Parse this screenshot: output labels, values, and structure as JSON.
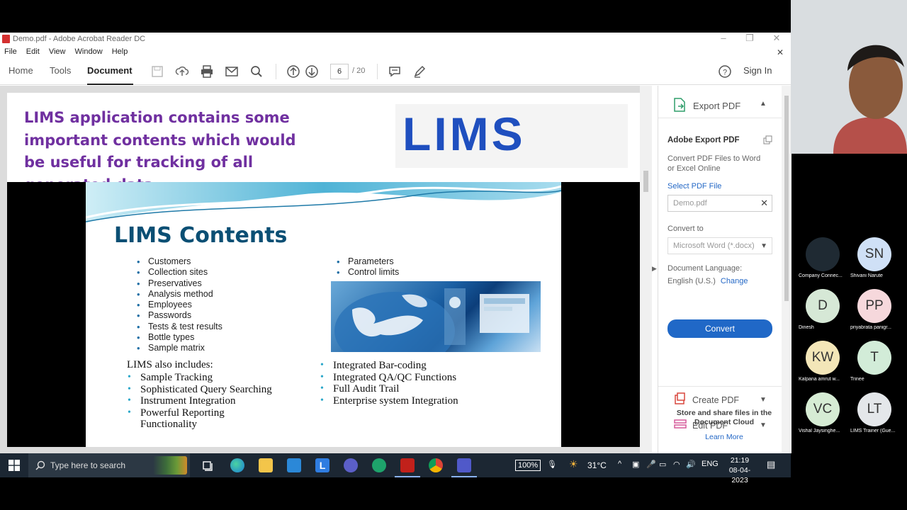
{
  "window": {
    "title": "Demo.pdf - Adobe Acrobat Reader DC",
    "menu": [
      "File",
      "Edit",
      "View",
      "Window",
      "Help"
    ]
  },
  "toolbar": {
    "tabs": [
      "Home",
      "Tools",
      "Document"
    ],
    "active_tab": "Document",
    "page_current": "6",
    "page_total": "/ 20",
    "sign_in": "Sign In"
  },
  "document": {
    "heading": "LIMS application contains some important contents which would be useful for tracking of all generated data.",
    "logo_text": "LIMS",
    "slide": {
      "title": "LIMS Contents",
      "left_list": [
        "Customers",
        "Collection sites",
        "Preservatives",
        "Analysis method",
        "Employees",
        "Passwords",
        "Tests & test results",
        "Bottle types",
        "Sample matrix"
      ],
      "right_list": [
        "Parameters",
        "Control limits"
      ],
      "includes_title": "LIMS also includes:",
      "includes_left": [
        "Sample Tracking",
        "Sophisticated Query Searching",
        "Instrument Integration",
        "Powerful Reporting Functionality"
      ],
      "includes_right": [
        "Integrated Bar-coding",
        "Integrated QA/QC Functions",
        "Full Audit Trail",
        "Enterprise system Integration"
      ]
    }
  },
  "right_panel": {
    "export_pdf": "Export PDF",
    "adobe_export_title": "Adobe Export PDF",
    "description": "Convert PDF Files to Word or Excel Online",
    "select_file": "Select PDF File",
    "file_name": "Demo.pdf",
    "convert_to_label": "Convert to",
    "convert_to_value": "Microsoft Word (*.docx)",
    "doc_language_label": "Document Language:",
    "doc_language_value": "English (U.S.)",
    "change_link": "Change",
    "convert_button": "Convert",
    "create_pdf": "Create PDF",
    "edit_pdf": "Edit PDF",
    "cloud_text": "Store and share files in the Document Cloud",
    "learn_more": "Learn More"
  },
  "taskbar": {
    "search_placeholder": "Type here to search",
    "zoom": "100%",
    "temperature": "31°C",
    "language": "ENG",
    "time": "21:19",
    "date": "08-04-2023"
  },
  "participants": [
    {
      "initials": "",
      "name": "Company Connec...",
      "color": "#1f2a33"
    },
    {
      "initials": "SN",
      "name": "Shivani Narute",
      "color": "#cfe0f6"
    },
    {
      "initials": "D",
      "name": "Dinesh",
      "color": "#d6e8d6"
    },
    {
      "initials": "PP",
      "name": "priyabrata panigr...",
      "color": "#f6d8dc"
    },
    {
      "initials": "KW",
      "name": "Kalpana amrut w...",
      "color": "#f3e6b8"
    },
    {
      "initials": "T",
      "name": "Trinee",
      "color": "#d2ecd8"
    },
    {
      "initials": "VC",
      "name": "Vishal Jaysinghe...",
      "color": "#d6ecd4"
    },
    {
      "initials": "LT",
      "name": "LIMS Trainer (Gue...",
      "color": "#e4e7ea"
    }
  ]
}
